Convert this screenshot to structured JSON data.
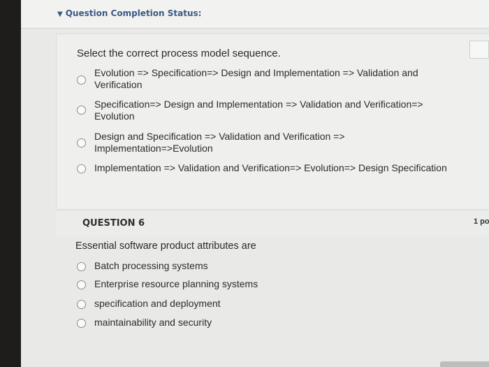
{
  "status": {
    "label": "Question Completion Status:",
    "chevron": "chevron-down-icon"
  },
  "q5": {
    "prompt": "Select the correct process model sequence.",
    "options": [
      {
        "line1": "Evolution => Specification=> Design and Implementation => Validation and",
        "line2": "Verification"
      },
      {
        "line1": "Specification=> Design and Implementation => Validation and Verification=>",
        "line2": "Evolution"
      },
      {
        "line1": "Design and Specification => Validation and Verification =>",
        "line2": "Implementation=>Evolution"
      },
      {
        "line1": "Implementation => Validation and Verification=> Evolution=> Design Specification",
        "line2": ""
      }
    ]
  },
  "q6": {
    "title": "QUESTION 6",
    "points": "1 po",
    "prompt": "Essential software product attributes are",
    "options": [
      {
        "label": "Batch processing systems"
      },
      {
        "label": "Enterprise resource planning systems"
      },
      {
        "label": "specification and deployment"
      },
      {
        "label": "maintainability and security"
      }
    ]
  }
}
